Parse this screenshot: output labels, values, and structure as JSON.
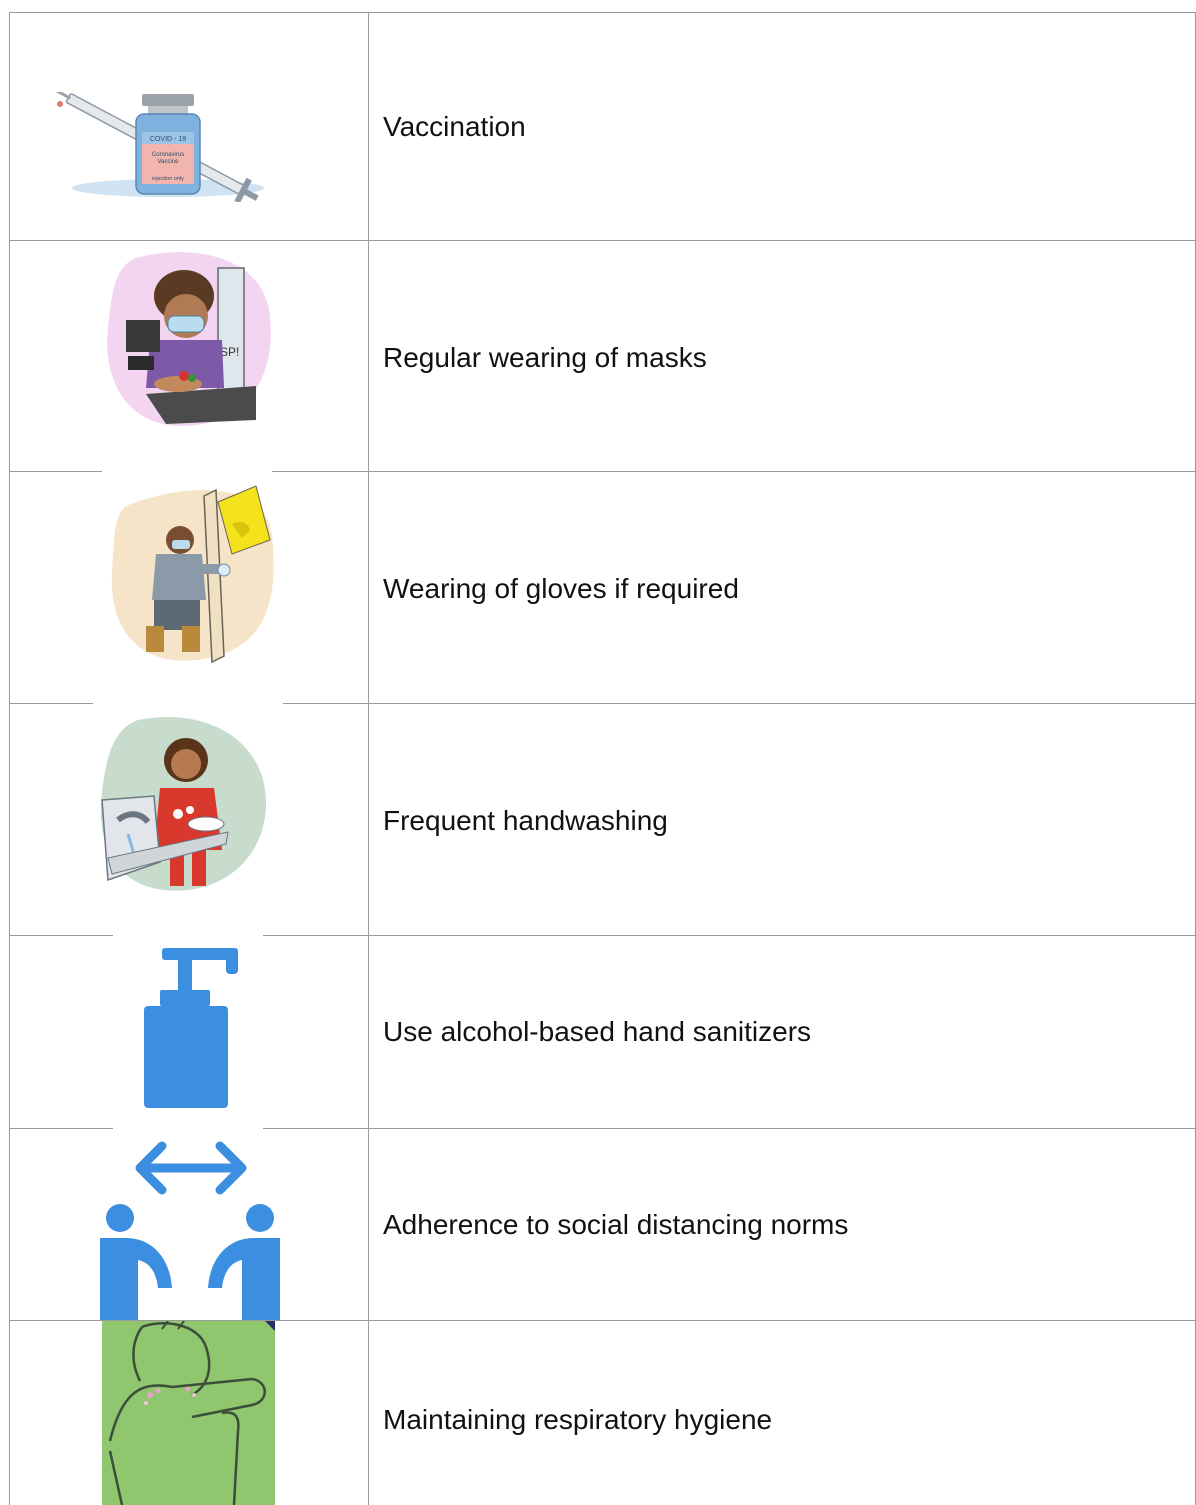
{
  "rows": [
    {
      "label": "Vaccination",
      "icon": "vaccine-vial-syringe-icon",
      "vial_text": {
        "line1": "COVID - 19",
        "line2": "Coronavirus",
        "line3": "Vaccine",
        "line4": "injection only"
      }
    },
    {
      "label": "Regular wearing of masks",
      "icon": "masked-cashier-icon",
      "sign_text": "SP!"
    },
    {
      "label": "Wearing of gloves if required",
      "icon": "gloved-worker-icon"
    },
    {
      "label": "Frequent handwashing",
      "icon": "handwashing-girl-icon"
    },
    {
      "label": "Use alcohol-based hand sanitizers",
      "icon": "sanitizer-bottle-icon"
    },
    {
      "label": "Adherence to social distancing norms",
      "icon": "social-distancing-icon"
    },
    {
      "label": "Maintaining respiratory hygiene",
      "icon": "cough-into-elbow-icon"
    }
  ],
  "colors": {
    "border": "#9a9a9a",
    "icon_blue": "#3b8ee0",
    "green_bg": "#8fc66e",
    "text": "#111111"
  }
}
